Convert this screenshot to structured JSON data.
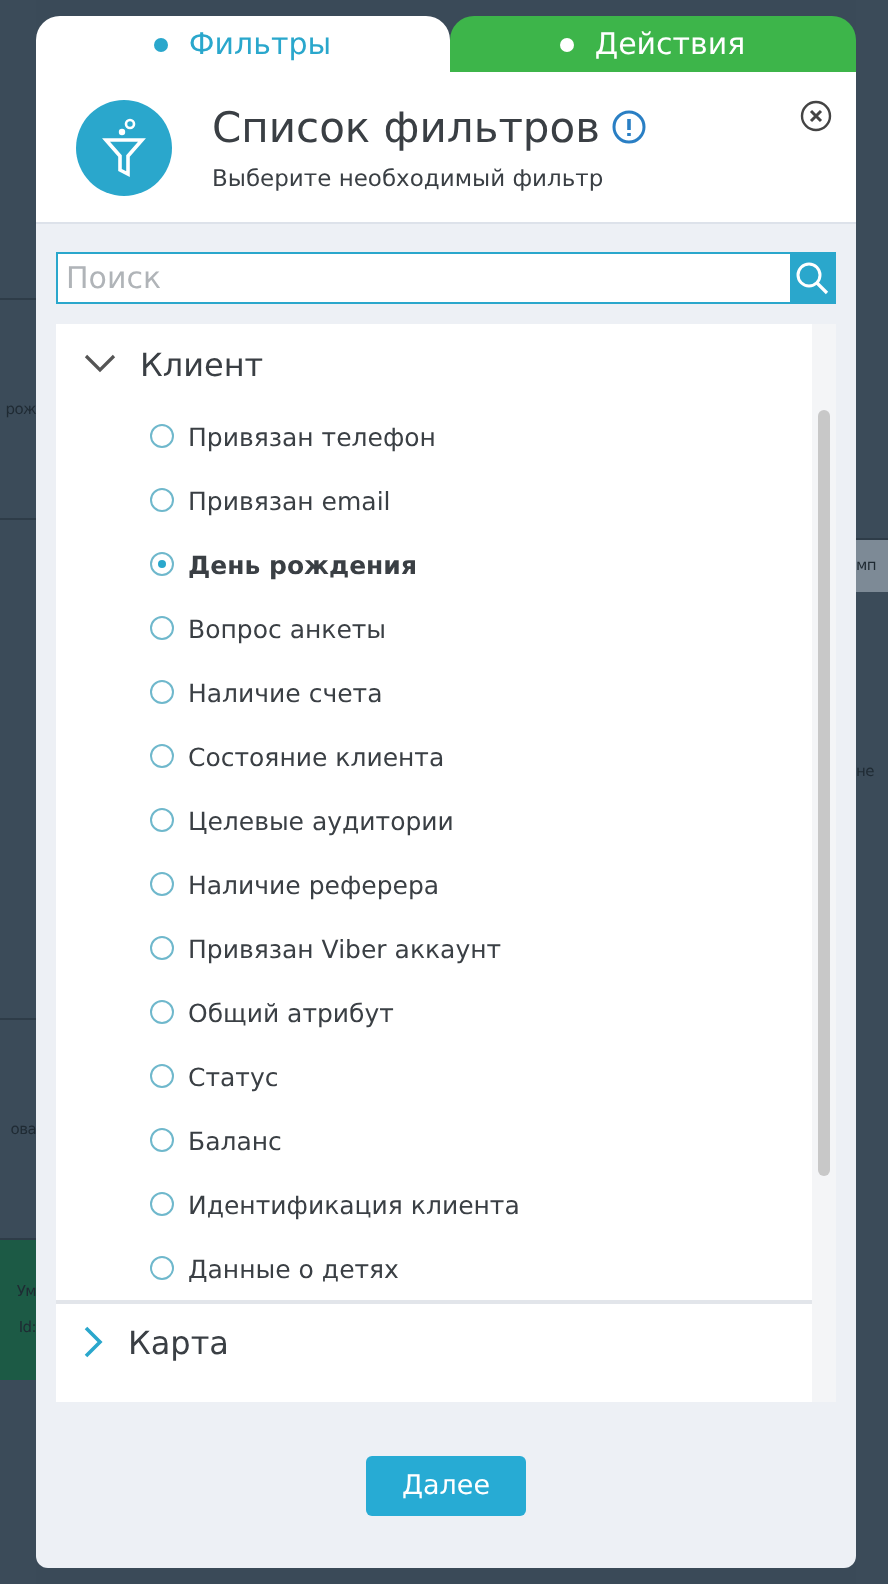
{
  "background": {
    "left": [
      "рож",
      "ова",
      "Ум",
      "Id:"
    ],
    "right": [
      "мп",
      "не"
    ]
  },
  "tabs": [
    {
      "label": "Фильтры",
      "selected": true
    },
    {
      "label": "Действия",
      "selected": false
    }
  ],
  "header": {
    "title": "Список фильтров",
    "subtitle": "Выберите необходимый фильтр"
  },
  "search": {
    "placeholder": "Поиск"
  },
  "groups": [
    {
      "label": "Клиент",
      "expanded": true,
      "children": [
        {
          "label": "Привязан телефон",
          "selected": false
        },
        {
          "label": "Привязан email",
          "selected": false
        },
        {
          "label": "День рождения",
          "selected": true
        },
        {
          "label": "Вопрос анкеты",
          "selected": false
        },
        {
          "label": "Наличие счета",
          "selected": false
        },
        {
          "label": "Состояние клиента",
          "selected": false
        },
        {
          "label": "Целевые аудитории",
          "selected": false
        },
        {
          "label": "Наличие реферера",
          "selected": false
        },
        {
          "label": "Привязан Viber аккаунт",
          "selected": false
        },
        {
          "label": "Общий атрибут",
          "selected": false
        },
        {
          "label": "Статус",
          "selected": false
        },
        {
          "label": "Баланс",
          "selected": false
        },
        {
          "label": "Идентификация клиента",
          "selected": false
        },
        {
          "label": "Данные о детях",
          "selected": false
        }
      ]
    },
    {
      "label": "Карта",
      "expanded": false
    }
  ],
  "button": "Далее"
}
